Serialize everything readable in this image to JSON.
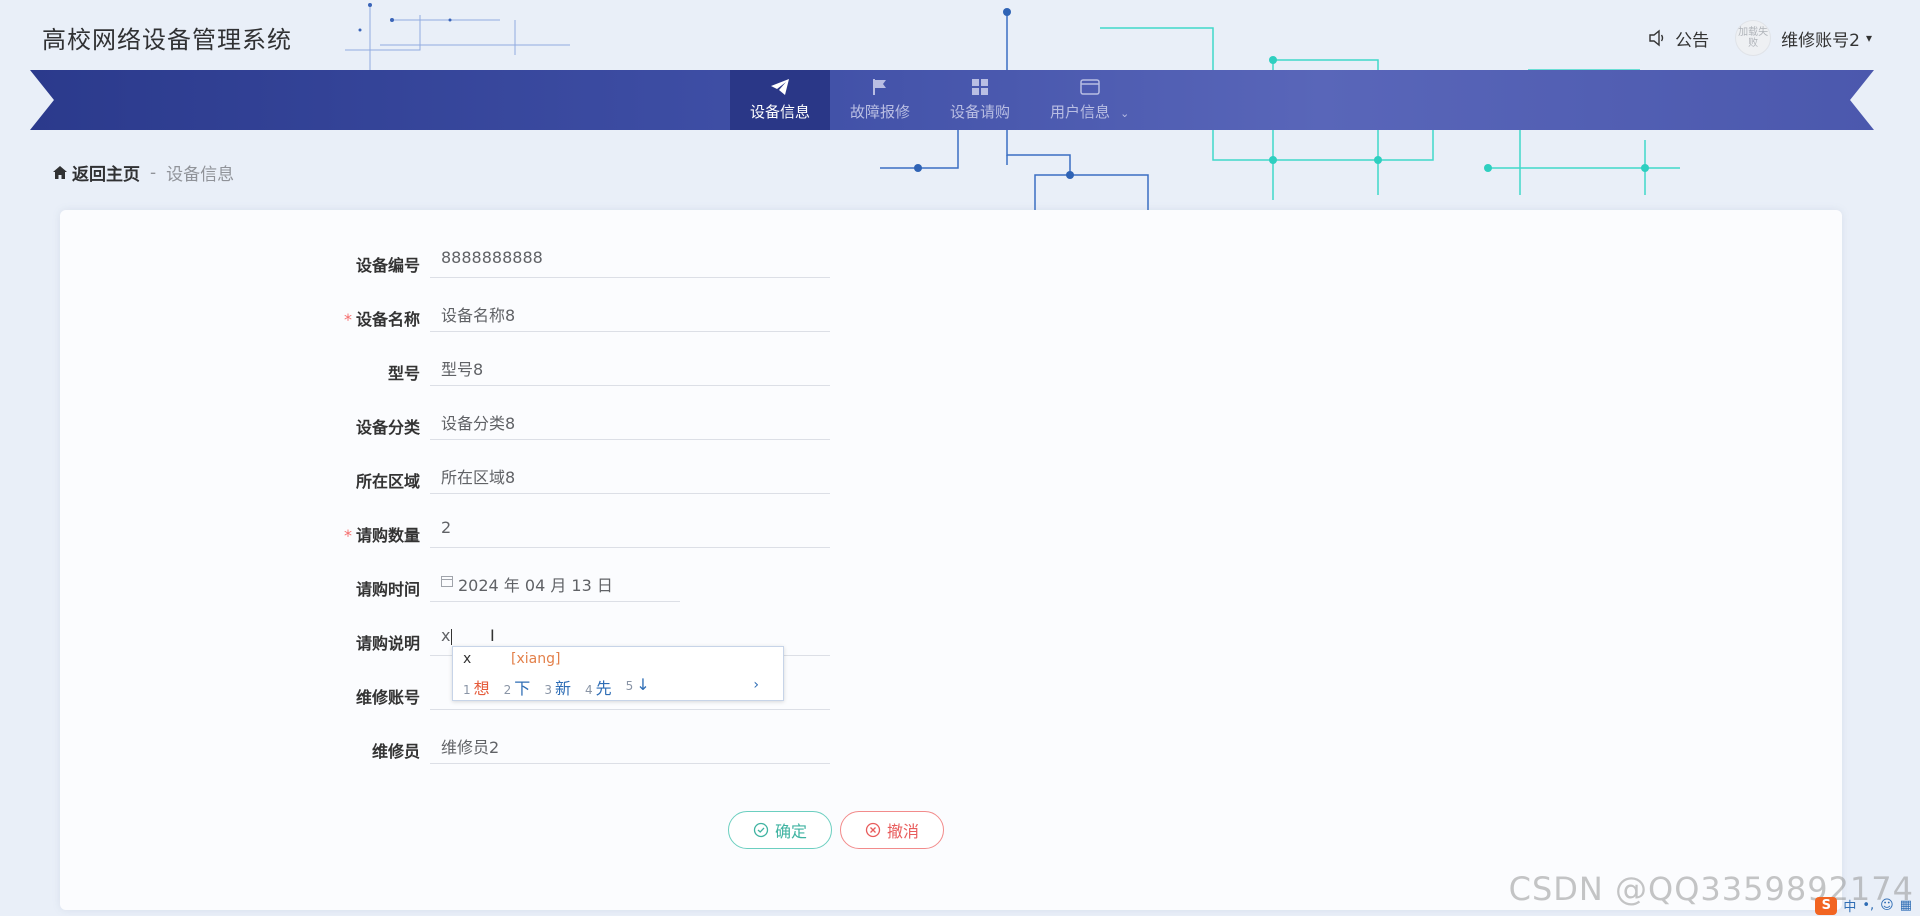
{
  "app": {
    "title": "高校网络设备管理系统"
  },
  "header": {
    "notice_label": "公告",
    "avatar_text": "加载失败",
    "user_name": "维修账号2",
    "user_caret": "▾"
  },
  "nav": {
    "items": [
      {
        "label": "设备信息",
        "icon": "paper-plane-icon",
        "active": true
      },
      {
        "label": "故障报修",
        "icon": "flag-icon",
        "active": false
      },
      {
        "label": "设备请购",
        "icon": "grid-icon",
        "active": false
      },
      {
        "label": "用户信息",
        "icon": "wallet-icon",
        "active": false,
        "dropdown": "⌄"
      }
    ]
  },
  "breadcrumb": {
    "home": "返回主页",
    "sep": "-",
    "current": "设备信息"
  },
  "form": {
    "fields": [
      {
        "label": "设备编号",
        "value": "8888888888",
        "required": false
      },
      {
        "label": "设备名称",
        "value": "设备名称8",
        "required": true
      },
      {
        "label": "型号",
        "value": "型号8",
        "required": false
      },
      {
        "label": "设备分类",
        "value": "设备分类8",
        "required": false
      },
      {
        "label": "所在区域",
        "value": "所在区域8",
        "required": false
      },
      {
        "label": "请购数量",
        "value": "2",
        "required": true
      },
      {
        "label": "请购时间",
        "value": "2024 年 04 月 13 日",
        "required": false
      },
      {
        "label": "请购说明",
        "value": "x",
        "required": false
      },
      {
        "label": "维修账号",
        "value": "",
        "required": false
      },
      {
        "label": "维修员",
        "value": "维修员2",
        "required": false
      }
    ],
    "required_mark": "*"
  },
  "ime": {
    "input": "x",
    "pinyin": "[xiang]",
    "candidates": [
      {
        "n": "1",
        "text": "想"
      },
      {
        "n": "2",
        "text": "下"
      },
      {
        "n": "3",
        "text": "新"
      },
      {
        "n": "4",
        "text": "先"
      },
      {
        "n": "5",
        "text": "↓"
      }
    ],
    "next": "›"
  },
  "buttons": {
    "ok": "确定",
    "cancel": "撤消"
  },
  "watermark": "CSDN @QQ3359892174",
  "tray": {
    "logo": "S",
    "lang": "中",
    "punct": "•,",
    "emoji": "☺",
    "kb": "▦"
  },
  "colors": {
    "accent": "#2a3787",
    "ok": "#3fb3a1",
    "cancel": "#e85c5c",
    "required": "#f56c6c"
  }
}
